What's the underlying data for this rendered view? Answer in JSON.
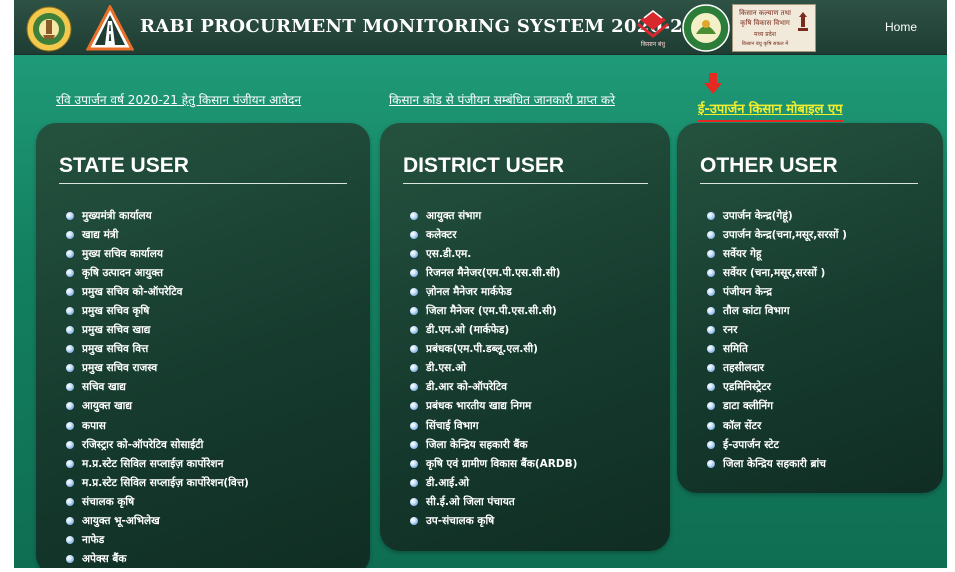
{
  "header": {
    "title": "RABI PROCURMENT MONITORING SYSTEM 2020-21",
    "home_label": "Home",
    "logo_red_caption": "किसान बंधु",
    "logo_box_lines": [
      "किसान कल्याण तथा",
      "कृषि विकास विभाग",
      "मध्य प्रदेश",
      "किसान बंधु कृषि सकल में"
    ]
  },
  "links": {
    "registration": "रवि उपार्जन वर्ष 2020-21 हेतु किसान पंजीयन आवेदन",
    "farmer_code": "किसान कोड से पंजीयन सम्बंधित जानकारी प्राप्त करे",
    "mobile_app": "ई-उपार्जन किसान मोबाइल एप"
  },
  "colors": {
    "header_bg": "#24473b",
    "main_bg": "#16876a",
    "card_bg": "#1a4436",
    "app_link": "#f3ed2f",
    "app_underline": "#e52a22"
  },
  "state_user": {
    "title": "STATE USER",
    "items": [
      "मुख्यमंत्री कार्यालय",
      "खाद्य मंत्री",
      "मुख्य सचिव कार्यालय",
      "कृषि उत्पादन आयुक्त",
      "प्रमुख सचिव को-ऑपरेटिव",
      "प्रमुख सचिव कृषि",
      "प्रमुख सचिव खाद्य",
      "प्रमुख सचिव वित्त",
      "प्रमुख सचिव राजस्व",
      "सचिव खाद्य",
      "आयुक्त खाद्य",
      "कपास",
      "रजिस्ट्रार को-ऑपरेटिव सोसाईटी",
      "म.प्र.स्टेट सिविल सप्लाईज़ कार्पोरेशन",
      "म.प्र.स्टेट सिविल सप्लाईज़ कार्पोरेशन(वित्त)",
      "संचालक कृषि",
      "आयुक्त भू-अभिलेख",
      "नाफेड",
      "अपेक्स बैंक"
    ]
  },
  "district_user": {
    "title": "DISTRICT USER",
    "items": [
      "आयुक्त संभाग",
      "कलेक्टर",
      "एस.डी.एम.",
      "रिजनल मैनेजर(एम.पी.एस.सी.सी)",
      "ज़ोनल मैनेजर मार्कफेड",
      "जिला मैनेजर (एम.पी.एस.सी.सी)",
      "डी.एम.ओ (मार्कफेड)",
      "प्रबंधक(एम.पी.डब्लू.एल.सी)",
      "डी.एस.ओ",
      "डी.आर को-ऑपरेटिव",
      "प्रबंधक भारतीय खाद्य निगम",
      "सिंचाई विभाग",
      "जिला केन्द्रिय सहकारी बैंक",
      "कृषि एवं ग्रामीण विकास बैंक(ARDB)",
      "डी.आई.ओ",
      "सी.ई.ओ जिला पंचायत",
      "उप-संचालक कृषि"
    ]
  },
  "other_user": {
    "title": "OTHER USER",
    "items": [
      "उपार्जन केन्द्र(गेहूं)",
      "उपार्जन केन्द्र(चना,मसूर,सरसों )",
      "सर्वेयर गेहू",
      "सर्वेयर (चना,मसूर,सरसों )",
      "पंजीयन केन्द्र",
      "तौल कांटा विभाग",
      "रनर",
      "समिति",
      "तहसीलदार",
      "एडमिनिस्ट्रेटर",
      "डाटा क्लीनिंग",
      "कॉल सेंटर",
      "ई-उपार्जन स्टेट",
      "जिला केन्द्रिय सहकारी ब्रांच"
    ]
  }
}
